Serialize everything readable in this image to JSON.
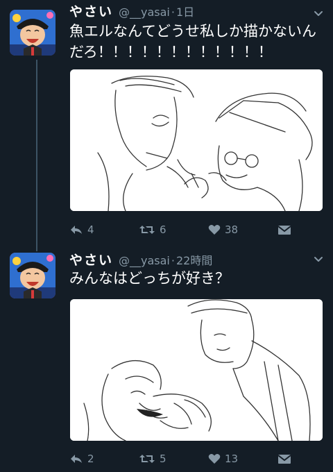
{
  "tweets": [
    {
      "display_name": "やさい",
      "handle": "@__yasai",
      "separator": "·",
      "time": "1日",
      "text": "魚エルなんてどうせ私しか描かないんだろ！！！！！！！！！！！！",
      "replies": "4",
      "retweets": "6",
      "likes": "38"
    },
    {
      "display_name": "やさい",
      "handle": "@__yasai",
      "separator": "·",
      "time": "22時間",
      "text": "みんなはどっちが好き？",
      "replies": "2",
      "retweets": "5",
      "likes": "13"
    }
  ],
  "icons": {
    "reply": "reply-icon",
    "retweet": "retweet-icon",
    "like": "heart-icon",
    "dm": "direct-message-icon",
    "menu": "chevron-down-icon"
  },
  "colors": {
    "background": "#141d26",
    "secondary_text": "#8899a6",
    "thread_line": "#3d5466"
  }
}
